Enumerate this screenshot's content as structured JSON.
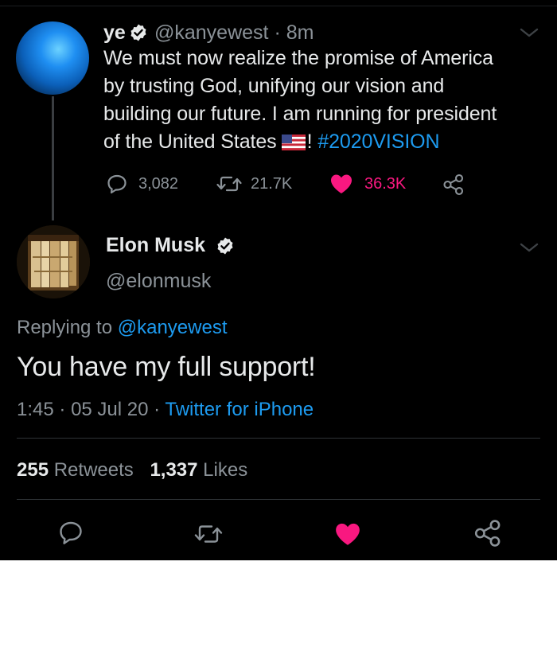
{
  "parent_tweet": {
    "display_name": "ye",
    "handle": "@kanyewest",
    "separator": "·",
    "time": "8m",
    "text_lines": [
      "We must now realize the promise of America",
      "by trusting God, unifying our vision and",
      "building our future. I am running for president"
    ],
    "text_last_prefix": "of the United States",
    "text_last_after_flag": "!",
    "hashtag": "#2020VISION",
    "replies": "3,082",
    "retweets": "21.7K",
    "likes": "36.3K"
  },
  "reply_tweet": {
    "display_name": "Elon Musk",
    "handle": "@elonmusk",
    "replying_label": "Replying to",
    "replying_to": "@kanyewest",
    "text": "You have my full support!",
    "time": "1:45",
    "date": "05 Jul 20",
    "separator": "·",
    "source": "Twitter for iPhone",
    "retweet_count": "255",
    "retweet_label": "Retweets",
    "like_count": "1,337",
    "like_label": "Likes"
  },
  "colors": {
    "background": "#000000",
    "text": "#e7e9ea",
    "secondary": "#8b9298",
    "link": "#1d9bf0",
    "like": "#f91880"
  },
  "icons": [
    "verified-badge-icon",
    "chevron-down-icon",
    "reply-icon",
    "retweet-icon",
    "heart-icon",
    "share-icon",
    "us-flag-icon"
  ]
}
